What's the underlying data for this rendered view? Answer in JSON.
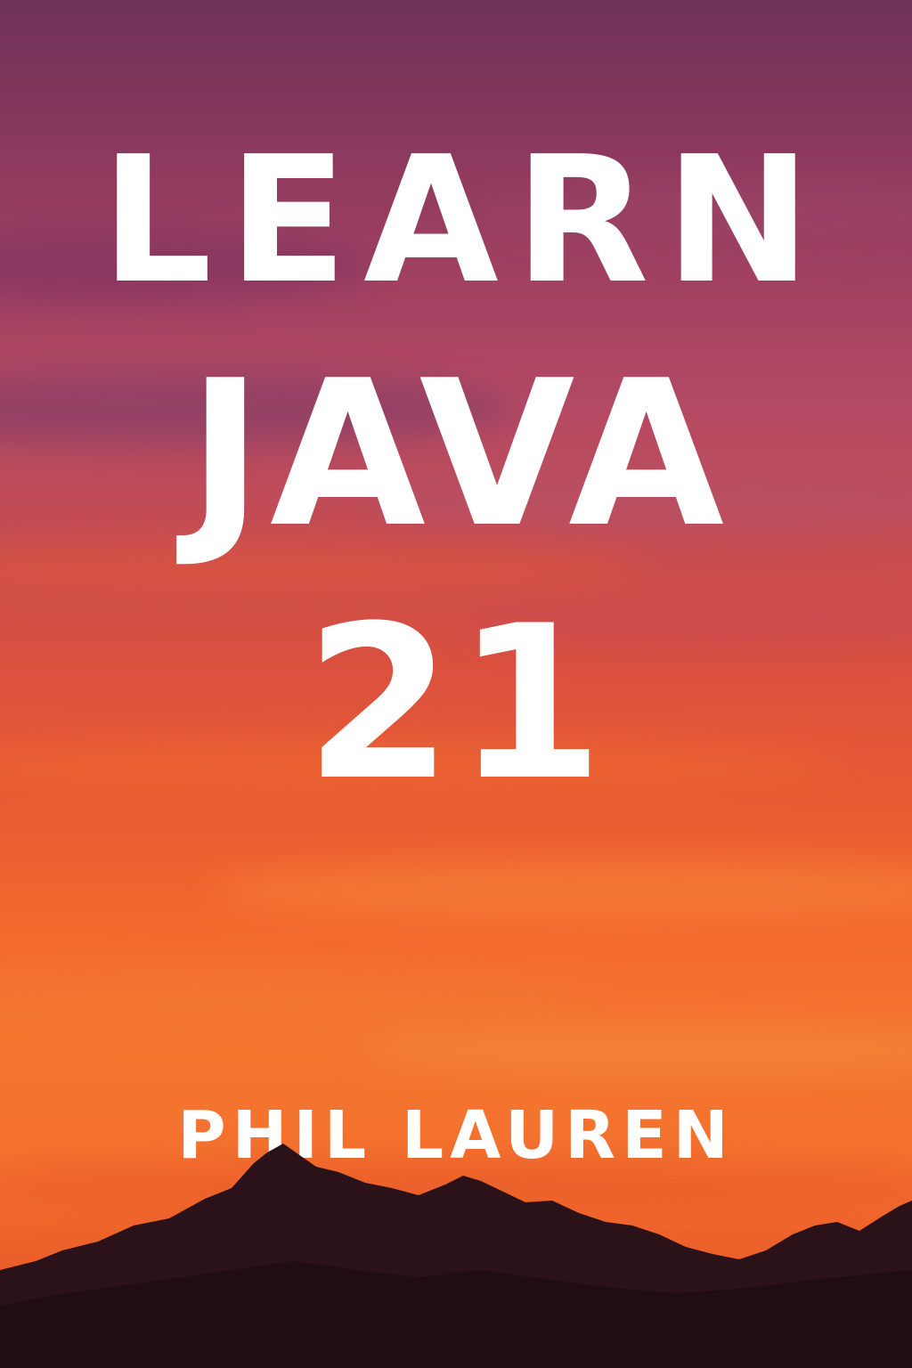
{
  "cover": {
    "title_line_1": "LEARN",
    "title_line_2": "JAVA",
    "title_line_3": "21",
    "author": "PHIL LAUREN"
  },
  "colors": {
    "text": "#ffffff",
    "sky_top": "#6e3258",
    "sky_middle": "#d9503f",
    "sky_bottom": "#f4722e",
    "mountain_silhouette": "#2a1218"
  }
}
